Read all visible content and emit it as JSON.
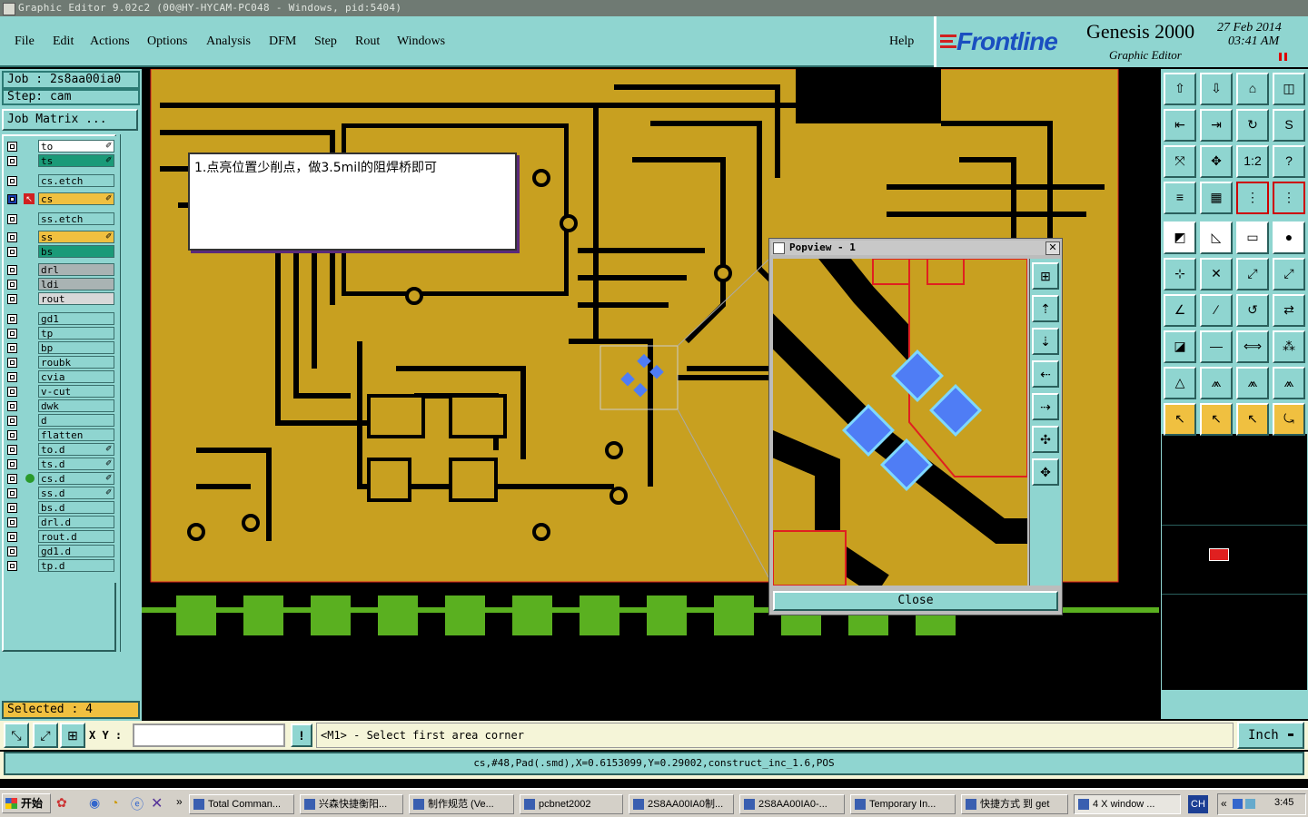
{
  "window_title": "Graphic Editor 9.02c2 (00@HY-HYCAM-PC048 - Windows, pid:5404)",
  "menu": [
    "File",
    "Edit",
    "Actions",
    "Options",
    "Analysis",
    "DFM",
    "Step",
    "Rout",
    "Windows"
  ],
  "help": "Help",
  "brand": {
    "logo": "Frontline",
    "product": "Genesis 2000",
    "subtitle": "Graphic Editor",
    "date": "27 Feb 2014",
    "time": "03:41 AM"
  },
  "job": {
    "job_label": "Job : 2s8aa00ia0",
    "step_label": "Step: cam",
    "matrix_button": "Job Matrix ..."
  },
  "layers": [
    {
      "name": "to",
      "color": "#ffffff",
      "mark": true
    },
    {
      "name": "ts",
      "color": "#1a9a78",
      "mark": true
    },
    {
      "name": "cs.etch",
      "color": "#8fd5d0",
      "mark": false
    },
    {
      "name": "cs",
      "color": "#f0c040",
      "mark": true,
      "active": true
    },
    {
      "name": "ss.etch",
      "color": "#8fd5d0",
      "mark": false
    },
    {
      "name": "ss",
      "color": "#f0c040",
      "mark": true
    },
    {
      "name": "bs",
      "color": "#1a9a78",
      "mark": false
    },
    {
      "name": "drl",
      "color": "#a9b3b3",
      "mark": false
    },
    {
      "name": "ldi",
      "color": "#a9b3b3",
      "mark": false
    },
    {
      "name": "rout",
      "color": "#d8d8d8",
      "mark": false
    },
    {
      "name": "gd1",
      "color": "#8fd5d0",
      "mark": false
    },
    {
      "name": "tp",
      "color": "#8fd5d0",
      "mark": false
    },
    {
      "name": "bp",
      "color": "#8fd5d0",
      "mark": false
    },
    {
      "name": "roubk",
      "color": "#8fd5d0",
      "mark": false
    },
    {
      "name": "cvia",
      "color": "#8fd5d0",
      "mark": false
    },
    {
      "name": "v-cut",
      "color": "#8fd5d0",
      "mark": false
    },
    {
      "name": "dwk",
      "color": "#8fd5d0",
      "mark": false
    },
    {
      "name": "d",
      "color": "#8fd5d0",
      "mark": false
    },
    {
      "name": "flatten",
      "color": "#8fd5d0",
      "mark": false
    },
    {
      "name": "to.d",
      "color": "#8fd5d0",
      "mark": true
    },
    {
      "name": "ts.d",
      "color": "#8fd5d0",
      "mark": true
    },
    {
      "name": "cs.d",
      "color": "#8fd5d0",
      "mark": true
    },
    {
      "name": "ss.d",
      "color": "#8fd5d0",
      "mark": true
    },
    {
      "name": "bs.d",
      "color": "#8fd5d0",
      "mark": false
    },
    {
      "name": "drl.d",
      "color": "#8fd5d0",
      "mark": false
    },
    {
      "name": "rout.d",
      "color": "#8fd5d0",
      "mark": false
    },
    {
      "name": "gd1.d",
      "color": "#8fd5d0",
      "mark": false
    },
    {
      "name": "tp.d",
      "color": "#8fd5d0",
      "mark": false
    }
  ],
  "selected": "Selected : 4",
  "annotation": "1.点亮位置少削点，做3.5mil的阻焊桥即可",
  "popview": {
    "title": "Popview - 1",
    "close": "Close"
  },
  "command": {
    "xy_label": "X Y :",
    "xy_value": "",
    "prompt": "<M1> - Select first area corner",
    "units": "Inch"
  },
  "status_line": "cs,#48,Pad(.smd),X=0.6153099,Y=0.29002,construct_inc_1.6,POS",
  "taskbar": {
    "start": "开始",
    "tasks": [
      "Total Comman...",
      "兴森快捷衡阳...",
      "制作规范 (Ve...",
      "pcbnet2002",
      "2S8AA00IA0制...",
      "2S8AA00IA0-...",
      "Temporary In...",
      "快捷方式 到 get",
      "4 X window ..."
    ],
    "lang": "CH",
    "clock": "3:45"
  },
  "colors": {
    "panel": "#8fd5d0",
    "copper": "#c8a020",
    "pad": "#4f7df5",
    "outline": "#e02020",
    "finger": "#5ab020"
  }
}
